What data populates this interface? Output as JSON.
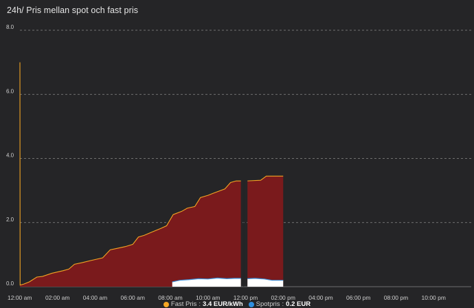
{
  "card": {
    "title": "24h/ Pris mellan spot och fast pris"
  },
  "colors": {
    "background": "#252527",
    "grid": "#8a8a8a",
    "fast_fill": "#7a1a1c",
    "fast_line": "#f5a623",
    "spot_fill": "#ffffff",
    "spot_line": "#3d8fd8",
    "spot_marker": "#2f8fe0"
  },
  "chart_data": {
    "type": "area",
    "ylim": [
      0,
      8
    ],
    "yticks": [
      "0.0",
      "2.0",
      "4.0",
      "6.0",
      "8.0"
    ],
    "xlim": [
      0,
      24
    ],
    "xticks": [
      {
        "h": 0,
        "label": "12:00 am"
      },
      {
        "h": 2,
        "label": "02:00 am"
      },
      {
        "h": 4,
        "label": "04:00 am"
      },
      {
        "h": 6,
        "label": "06:00 am"
      },
      {
        "h": 8,
        "label": "08:00 am"
      },
      {
        "h": 10,
        "label": "10:00 am"
      },
      {
        "h": 12,
        "label": "12:00 pm"
      },
      {
        "h": 14,
        "label": "02:00 pm"
      },
      {
        "h": 16,
        "label": "04:00 pm"
      },
      {
        "h": 18,
        "label": "06:00 pm"
      },
      {
        "h": 20,
        "label": "08:00 pm"
      },
      {
        "h": 22,
        "label": "10:00 pm"
      }
    ],
    "grid": true,
    "series": [
      {
        "name": "Fast Pris",
        "legend_value": "3.4 EUR/kWh",
        "segments": [
          [
            [
              0,
              7.0
            ],
            [
              0.01,
              0.05
            ],
            [
              0.2,
              0.08
            ],
            [
              0.5,
              0.15
            ],
            [
              0.9,
              0.3
            ],
            [
              1.2,
              0.32
            ],
            [
              1.7,
              0.42
            ],
            [
              2.3,
              0.5
            ],
            [
              2.6,
              0.55
            ],
            [
              2.9,
              0.7
            ],
            [
              3.3,
              0.75
            ],
            [
              3.8,
              0.82
            ],
            [
              4.4,
              0.9
            ],
            [
              4.8,
              1.15
            ],
            [
              5.2,
              1.2
            ],
            [
              5.6,
              1.25
            ],
            [
              6.0,
              1.32
            ],
            [
              6.3,
              1.55
            ],
            [
              6.6,
              1.6
            ],
            [
              7.0,
              1.7
            ],
            [
              7.5,
              1.82
            ],
            [
              7.8,
              1.9
            ],
            [
              8.15,
              2.25
            ],
            [
              8.6,
              2.35
            ],
            [
              8.9,
              2.45
            ],
            [
              9.3,
              2.5
            ],
            [
              9.6,
              2.78
            ],
            [
              10.0,
              2.85
            ],
            [
              10.3,
              2.92
            ],
            [
              10.9,
              3.05
            ],
            [
              11.2,
              3.25
            ],
            [
              11.5,
              3.3
            ],
            [
              11.75,
              3.3
            ]
          ],
          [
            [
              12.1,
              3.3
            ],
            [
              12.8,
              3.32
            ],
            [
              13.1,
              3.45
            ],
            [
              14.0,
              3.45
            ]
          ]
        ]
      },
      {
        "name": "Spotpris",
        "legend_value": "0.2 EUR",
        "segments": [
          [
            [
              8.1,
              0.15
            ],
            [
              8.5,
              0.2
            ],
            [
              9.0,
              0.22
            ],
            [
              9.5,
              0.25
            ],
            [
              10.0,
              0.24
            ],
            [
              10.5,
              0.27
            ],
            [
              11.0,
              0.25
            ],
            [
              11.4,
              0.26
            ],
            [
              11.75,
              0.26
            ]
          ],
          [
            [
              12.1,
              0.25
            ],
            [
              12.5,
              0.26
            ],
            [
              13.0,
              0.24
            ],
            [
              13.4,
              0.2
            ],
            [
              14.0,
              0.2
            ]
          ]
        ]
      }
    ]
  }
}
